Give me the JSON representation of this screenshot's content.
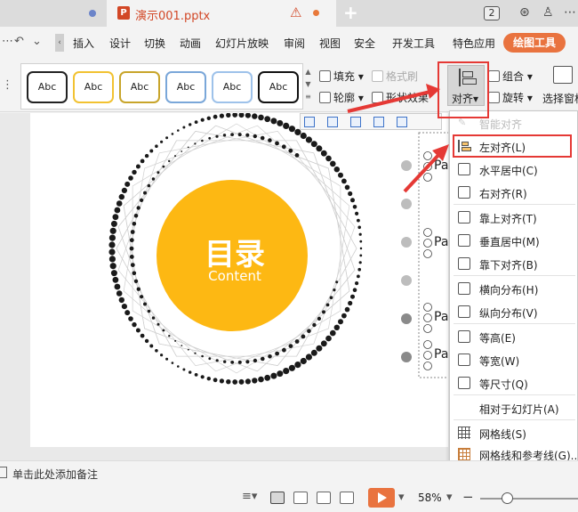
{
  "tabbar": {
    "file_name": "演示001.pptx",
    "file_icon_letter": "P",
    "count_badge": "2"
  },
  "ribbon_tabs": [
    "插入",
    "设计",
    "切换",
    "动画",
    "幻灯片放映",
    "审阅",
    "视图",
    "安全",
    "开发工具",
    "特色应用"
  ],
  "ribbon_context_tab": "绘图工具",
  "shape_styles": [
    "Abc",
    "Abc",
    "Abc",
    "Abc",
    "Abc",
    "Abc"
  ],
  "shape_style_colors": [
    "#222222",
    "#f2c231",
    "#c8a52b",
    "#7aa7d9",
    "#9ec2ea",
    "#111111"
  ],
  "ribbon_buttons": {
    "fill": "填充",
    "format_brush": "格式刷",
    "outline": "轮廓",
    "shape_effects": "形状效果",
    "align": "对齐",
    "group": "组合",
    "rotate": "旋转",
    "selection_pane": "选择窗格"
  },
  "slide": {
    "title": "目录",
    "subtitle": "Content",
    "part_labels": [
      "Pa",
      "Pa",
      "Pa",
      "Pa"
    ],
    "accent_color": "#fdb813"
  },
  "align_menu": {
    "items": [
      {
        "label": "智能对齐",
        "disabled": true
      },
      {
        "label": "左对齐(L)",
        "highlighted": true
      },
      {
        "label": "水平居中(C)"
      },
      {
        "label": "右对齐(R)"
      },
      {
        "label": "靠上对齐(T)"
      },
      {
        "label": "垂直居中(M)"
      },
      {
        "label": "靠下对齐(B)"
      },
      {
        "label": "横向分布(H)"
      },
      {
        "label": "纵向分布(V)"
      },
      {
        "label": "等高(E)"
      },
      {
        "label": "等宽(W)"
      },
      {
        "label": "等尺寸(Q)"
      },
      {
        "label": "相对于幻灯片(A)"
      },
      {
        "label": "网格线(S)"
      },
      {
        "label": "网格线和参考线(G)..."
      }
    ]
  },
  "notes": {
    "placeholder": "单击此处添加备注"
  },
  "statusbar": {
    "zoom": "58%",
    "zoom_fraction": 0.27
  },
  "colors": {
    "highlight": "#e53935",
    "context_tab": "#e9733f"
  }
}
